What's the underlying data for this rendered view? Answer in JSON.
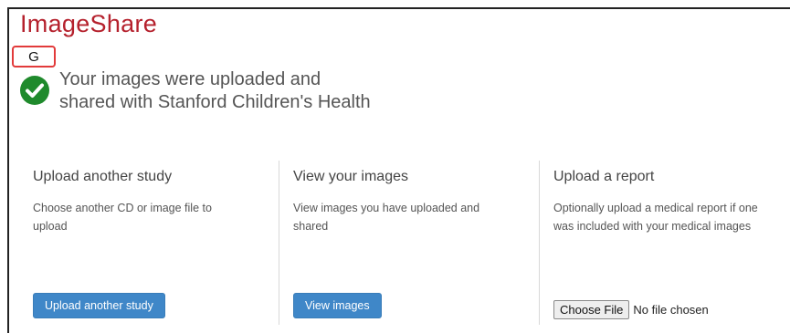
{
  "header": {
    "brand": "ImageShare"
  },
  "overlay": {
    "key_label": "G"
  },
  "status": {
    "line1": "Your images were uploaded and",
    "line2": "shared with Stanford Children's Health",
    "color": "#1f8a2c"
  },
  "columns": [
    {
      "title": "Upload another study",
      "description_lines": [
        "Choose another CD or image file to",
        "upload"
      ],
      "button": "Upload another study"
    },
    {
      "title": "View your images",
      "description_lines": [
        "View images you have uploaded and",
        "shared"
      ],
      "button": "View images"
    },
    {
      "title": "Upload a report",
      "description_lines": [
        "Optionally upload a medical report if one",
        "was included with your medical images"
      ],
      "file_button": "Choose File",
      "file_status": "No file chosen"
    }
  ],
  "colors": {
    "brand": "#b5212d",
    "button": "#3f87c8",
    "highlight": "#e23b3b"
  }
}
